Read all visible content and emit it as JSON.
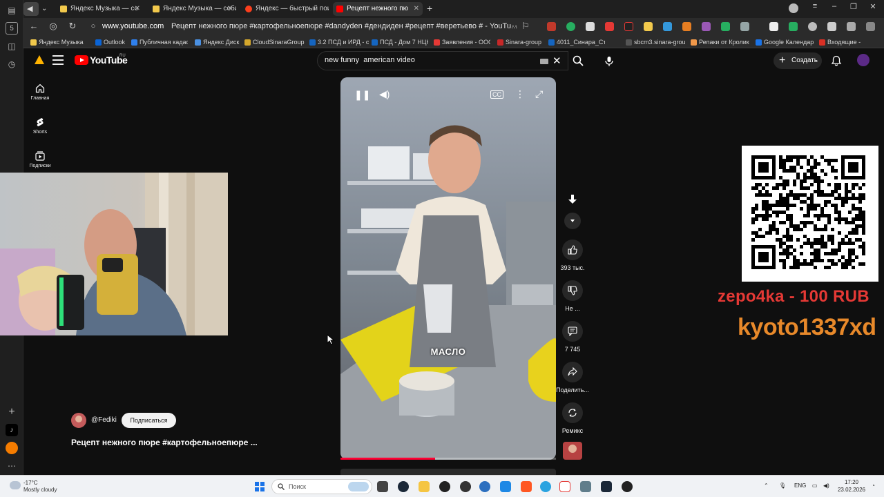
{
  "browser": {
    "tabs": [
      {
        "title": "Яндекс Музыка — со",
        "fav_color": "#f2c94c",
        "active": false
      },
      {
        "title": "Яндекс Музыка — собир",
        "fav_color": "#f2c94c",
        "active": false
      },
      {
        "title": "Яндекс — быстрый поис",
        "fav_color": "#fc3f1d",
        "active": false
      },
      {
        "title": "Рецепт нежного пю",
        "fav_color": "#ff0000",
        "active": true
      }
    ],
    "url_domain": "www.youtube.com",
    "url_title": "Рецепт нежного пюре #картофельноепюре #dandyden #дендиден #рецепт #веретьево # - YouTu...",
    "side_rail_badge": "5",
    "bookmarks": [
      {
        "label": "Яндекс Музыка —",
        "color": "#f2c94c"
      },
      {
        "label": "Outlook",
        "color": "#0a64d6"
      },
      {
        "label": "Публичная кадас",
        "color": "#2f80ed"
      },
      {
        "label": "Яндекс Диск",
        "color": "#4a90e2"
      },
      {
        "label": "CloudSinaraGroup",
        "color": "#d4a72c"
      },
      {
        "label": "3.2 ПСД и ИРД - с",
        "color": "#1565c0"
      },
      {
        "label": "ПСД - Дом 7 НЦК",
        "color": "#1565c0"
      },
      {
        "label": "Заявления - ООО",
        "color": "#e53935"
      },
      {
        "label": "Sinara-group",
        "color": "#c62828"
      },
      {
        "label": "4011_Синара_Ст",
        "color": "#1565c0"
      },
      {
        "label": "sbcm3.sinara-grou",
        "color": "#555555"
      },
      {
        "label": "Репаки от Кролик",
        "color": "#f2994a"
      },
      {
        "label": "Google Календар",
        "color": "#1a73e8"
      },
      {
        "label": "Входящие -",
        "color": "#d93025"
      }
    ]
  },
  "youtube": {
    "logo_text": "YouTube",
    "region": "RU",
    "search_value": "new funny  american video",
    "create_label": "Создать",
    "nav": [
      {
        "label": "Главная",
        "icon": "home-icon"
      },
      {
        "label": "Shorts",
        "icon": "shorts-icon"
      },
      {
        "label": "Подписки",
        "icon": "subscriptions-icon"
      }
    ],
    "video": {
      "caption": "МАСЛО",
      "progress": 0.44
    },
    "actions": [
      {
        "label": "393 тыс.",
        "icon": "like-icon"
      },
      {
        "label": "Не ...",
        "icon": "dislike-icon"
      },
      {
        "label": "7 745",
        "icon": "comments-icon"
      },
      {
        "label": "Поделить...",
        "icon": "share-icon"
      },
      {
        "label": "Ремикс",
        "icon": "remix-icon"
      }
    ],
    "channel": "@Fediki",
    "subscribe_label": "Подписаться",
    "title": "Рецепт нежного пюре #картофельноепюре ..."
  },
  "overlay": {
    "donation": "zepo4ka - 100 RUB",
    "donor": "kyoto1337xd"
  },
  "taskbar": {
    "weather_temp": "-17°C",
    "weather_desc": "Mostly cloudy",
    "search_placeholder": "Поиск",
    "lang": "ENG",
    "time": "17:20",
    "date": "23.02.2026"
  }
}
